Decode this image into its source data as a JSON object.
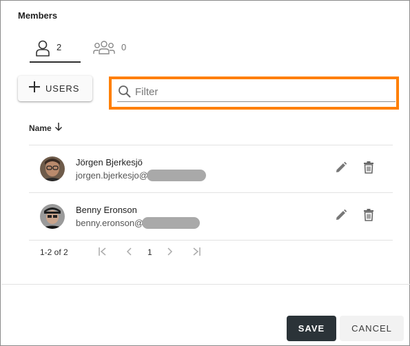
{
  "dialog": {
    "title": "Members"
  },
  "tabs": [
    {
      "label": "2",
      "icon": "user-icon",
      "active": true
    },
    {
      "label": "0",
      "icon": "group-icon",
      "active": false
    }
  ],
  "toolbar": {
    "add_users_label": "USERS"
  },
  "filter": {
    "placeholder": "Filter",
    "value": ""
  },
  "table": {
    "column_name": "Name",
    "sort_direction": "descending",
    "rows": [
      {
        "name": "Jörgen Bjerkesjö",
        "email_visible": "jorgen.bjerkesjo@",
        "email_redacted": true
      },
      {
        "name": "Benny Eronson",
        "email_visible": "benny.eronson@",
        "email_redacted": true
      }
    ]
  },
  "pagination": {
    "range": "1-2 of 2",
    "page": "1"
  },
  "footer": {
    "save_label": "SAVE",
    "cancel_label": "CANCEL"
  },
  "colors": {
    "highlight": "#ff7f00",
    "primary_button": "#2b3338"
  }
}
